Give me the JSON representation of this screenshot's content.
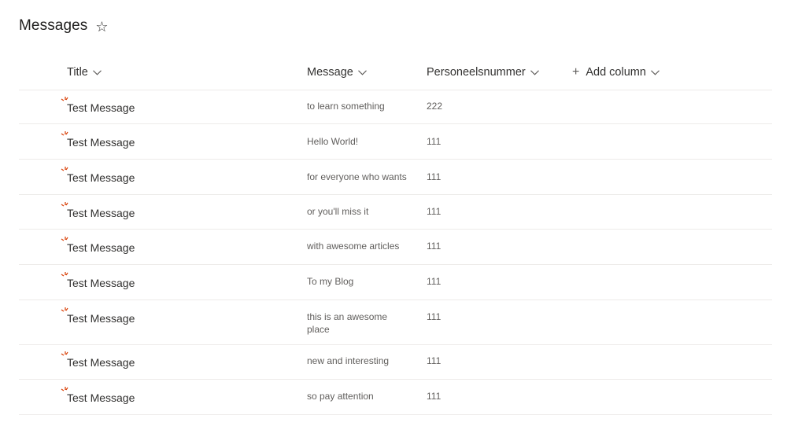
{
  "page": {
    "title": "Messages"
  },
  "columns": {
    "title": "Title",
    "message": "Message",
    "number": "Personeelsnummer",
    "add": "Add column"
  },
  "rows": [
    {
      "title": "Test Message",
      "message": "to learn something",
      "number": "222"
    },
    {
      "title": "Test Message",
      "message": "Hello World!",
      "number": "111"
    },
    {
      "title": "Test Message",
      "message": "for everyone who wants",
      "number": "111"
    },
    {
      "title": "Test Message",
      "message": "or you'll miss it",
      "number": "111"
    },
    {
      "title": "Test Message",
      "message": "with awesome articles",
      "number": "111"
    },
    {
      "title": "Test Message",
      "message": "To my Blog",
      "number": "111"
    },
    {
      "title": "Test Message",
      "message": "this is an awesome place",
      "number": "111"
    },
    {
      "title": "Test Message",
      "message": "new and interesting",
      "number": "111"
    },
    {
      "title": "Test Message",
      "message": "so pay attention",
      "number": "111"
    }
  ],
  "colors": {
    "new_indicator": "#d83b01",
    "divider": "#edebe9"
  },
  "icons": {
    "favorite": "star-outline-icon",
    "sort": "chevron-down-icon",
    "new_item": "new-item-icon",
    "add": "plus-icon"
  }
}
